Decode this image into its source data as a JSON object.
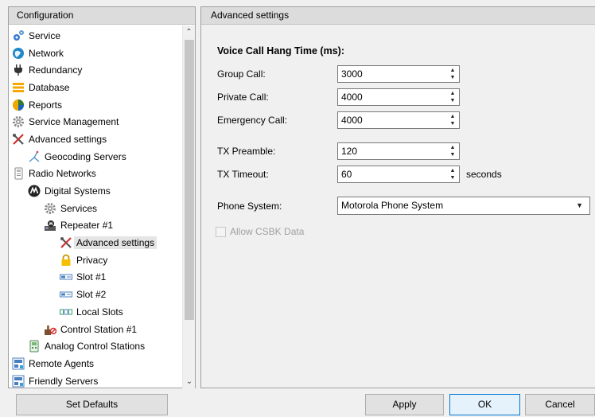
{
  "left_panel": {
    "title": "Configuration",
    "tree": [
      {
        "label": "Service",
        "icon": "service-gears-icon",
        "indent": 0
      },
      {
        "label": "Network",
        "icon": "network-globe-icon",
        "indent": 0
      },
      {
        "label": "Redundancy",
        "icon": "redundancy-plug-icon",
        "indent": 0
      },
      {
        "label": "Database",
        "icon": "database-icon",
        "indent": 0
      },
      {
        "label": "Reports",
        "icon": "reports-icon",
        "indent": 0
      },
      {
        "label": "Service Management",
        "icon": "gear-icon",
        "indent": 0
      },
      {
        "label": "Advanced settings",
        "icon": "tools-icon",
        "indent": 0
      },
      {
        "label": "Geocoding Servers",
        "icon": "geocoding-icon",
        "indent": 1
      },
      {
        "label": "Radio Networks",
        "icon": "radio-networks-icon",
        "indent": 0
      },
      {
        "label": "Digital Systems",
        "icon": "motorola-logo-icon",
        "indent": 1
      },
      {
        "label": "Services",
        "icon": "gear-icon",
        "indent": 2
      },
      {
        "label": "Repeater #1",
        "icon": "repeater-icon",
        "indent": 2
      },
      {
        "label": "Advanced settings",
        "icon": "tools-icon",
        "indent": 3,
        "selected": true
      },
      {
        "label": "Privacy",
        "icon": "lock-icon",
        "indent": 3
      },
      {
        "label": "Slot #1",
        "icon": "slot-icon",
        "indent": 3
      },
      {
        "label": "Slot #2",
        "icon": "slot-icon",
        "indent": 3
      },
      {
        "label": "Local Slots",
        "icon": "local-slots-icon",
        "indent": 3
      },
      {
        "label": "Control Station #1",
        "icon": "control-station-icon",
        "indent": 2
      },
      {
        "label": "Analog Control Stations",
        "icon": "analog-station-icon",
        "indent": 1
      },
      {
        "label": "Remote Agents",
        "icon": "remote-agents-icon",
        "indent": 0
      },
      {
        "label": "Friendly Servers",
        "icon": "friendly-servers-icon",
        "indent": 0
      }
    ]
  },
  "right_panel": {
    "title": "Advanced settings",
    "section_title": "Voice Call Hang Time (ms):",
    "fields": {
      "group_call": {
        "label": "Group Call:",
        "value": "3000"
      },
      "private_call": {
        "label": "Private Call:",
        "value": "4000"
      },
      "emergency_call": {
        "label": "Emergency Call:",
        "value": "4000"
      },
      "tx_preamble": {
        "label": "TX Preamble:",
        "value": "120"
      },
      "tx_timeout": {
        "label": "TX Timeout:",
        "value": "60",
        "unit": "seconds"
      },
      "phone_system": {
        "label": "Phone System:",
        "value": "Motorola Phone System"
      }
    },
    "allow_csbk": {
      "label": "Allow CSBK Data",
      "checked": false,
      "enabled": false
    }
  },
  "buttons": {
    "set_defaults": "Set Defaults",
    "apply": "Apply",
    "ok": "OK",
    "cancel": "Cancel"
  },
  "colors": {
    "accent": "#0078d7",
    "panel_header": "#dcdcdc",
    "selection": "#e5e5e5"
  }
}
